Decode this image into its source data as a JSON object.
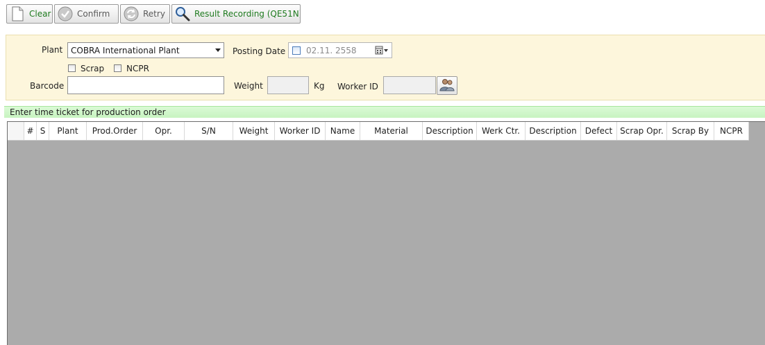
{
  "toolbar": {
    "clear_label": "Clear",
    "confirm_label": "Confirm",
    "retry_label": "Retry",
    "result_recording_label": "Result Recording (QE51N)"
  },
  "form": {
    "plant_label": "Plant",
    "plant_value": "COBRA International Plant",
    "posting_date_label": "Posting Date",
    "posting_date_value": "02.11. 2558",
    "scrap_label": "Scrap",
    "ncpr_label": "NCPR",
    "barcode_label": "Barcode",
    "barcode_value": "",
    "weight_label": "Weight",
    "weight_value": "",
    "weight_unit": "Kg",
    "worker_id_label": "Worker ID",
    "worker_id_value": ""
  },
  "section": {
    "title": "Enter time ticket for production order"
  },
  "grid": {
    "columns": [
      "#",
      "S",
      "Plant",
      "Prod.Order",
      "Opr.",
      "S/N",
      "Weight",
      "Worker ID",
      "Name",
      "Material",
      "Description",
      "Werk Ctr.",
      "Description",
      "Defect",
      "Scrap Opr.",
      "Scrap By",
      "NCPR"
    ]
  },
  "colors": {
    "panel_bg": "#fdf6dc",
    "section_bg": "#c7f3c0",
    "grid_bg": "#ababab",
    "button_text_green": "#1e7a1e"
  },
  "icons": [
    "new-document-icon",
    "confirm-check-icon",
    "retry-icon",
    "search-icon",
    "calendar-icon",
    "user-group-icon"
  ]
}
